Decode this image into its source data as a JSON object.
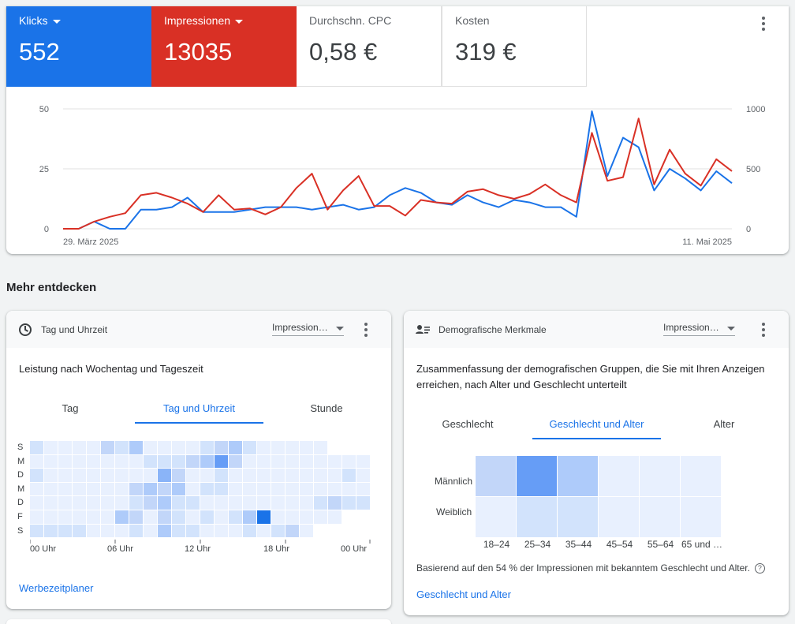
{
  "metrics": [
    {
      "label": "Klicks",
      "value": "552",
      "color": "#1a73e8"
    },
    {
      "label": "Impressionen",
      "value": "13035",
      "color": "#d93025"
    },
    {
      "label": "Durchschn. CPC",
      "value": "0,58 €"
    },
    {
      "label": "Kosten",
      "value": "319 €"
    }
  ],
  "chart_data": {
    "type": "line",
    "x_start_label": "29. März 2025",
    "x_end_label": "11. Mai 2025",
    "left_axis": {
      "ticks": [
        "0",
        "25",
        "50"
      ],
      "ylim": [
        0,
        50
      ]
    },
    "right_axis": {
      "ticks": [
        "0",
        "500",
        "1000"
      ],
      "ylim": [
        0,
        1000
      ]
    },
    "grid": true,
    "series": [
      {
        "name": "Klicks",
        "axis": "left",
        "color": "#1a73e8",
        "values": [
          0,
          0,
          3,
          0,
          0,
          8,
          8,
          9,
          13,
          7,
          7,
          7,
          8,
          9,
          9,
          9,
          8,
          9,
          10,
          8,
          9,
          14,
          17,
          15,
          11,
          10,
          14,
          11,
          9,
          12,
          11,
          9,
          9,
          5,
          49,
          22,
          38,
          34,
          16,
          25,
          21,
          16,
          24,
          19
        ]
      },
      {
        "name": "Impressionen",
        "axis": "right",
        "color": "#d93025",
        "values": [
          0,
          0,
          60,
          100,
          130,
          280,
          300,
          260,
          210,
          140,
          280,
          160,
          170,
          120,
          180,
          340,
          460,
          160,
          320,
          440,
          190,
          190,
          110,
          240,
          220,
          210,
          310,
          330,
          280,
          250,
          290,
          370,
          280,
          220,
          800,
          400,
          430,
          920,
          370,
          660,
          460,
          360,
          580,
          480
        ]
      }
    ]
  },
  "section_title": "Mehr entdecken",
  "card1": {
    "title": "Tag und Uhrzeit",
    "dropdown": "Impression…",
    "subtitle": "Leistung nach Wochentag und Tageszeit",
    "tabs": [
      "Tag",
      "Tag und Uhrzeit",
      "Stunde"
    ],
    "active_tab": 1,
    "row_labels": [
      "S",
      "M",
      "D",
      "M",
      "D",
      "F",
      "S"
    ],
    "x_ticks": [
      "00 Uhr",
      "06 Uhr",
      "12 Uhr",
      "18 Uhr",
      "00 Uhr"
    ],
    "link": "Werbezeitplaner",
    "heatmap_levels": [
      [
        2,
        1,
        1,
        1,
        1,
        3,
        2,
        4,
        1,
        1,
        1,
        1,
        2,
        3,
        4,
        2,
        1,
        1,
        1,
        1,
        1,
        0,
        0,
        0
      ],
      [
        1,
        1,
        1,
        1,
        1,
        1,
        1,
        1,
        2,
        2,
        2,
        3,
        4,
        6,
        3,
        1,
        1,
        1,
        1,
        1,
        1,
        1,
        1,
        1
      ],
      [
        2,
        1,
        1,
        1,
        1,
        1,
        1,
        1,
        1,
        5,
        3,
        1,
        1,
        2,
        1,
        1,
        1,
        1,
        1,
        1,
        1,
        1,
        2,
        1
      ],
      [
        1,
        1,
        1,
        1,
        1,
        1,
        1,
        3,
        4,
        3,
        4,
        1,
        2,
        2,
        1,
        1,
        1,
        1,
        1,
        1,
        1,
        1,
        1,
        1
      ],
      [
        1,
        1,
        1,
        1,
        1,
        1,
        1,
        2,
        3,
        4,
        2,
        2,
        1,
        1,
        1,
        1,
        1,
        1,
        1,
        1,
        2,
        3,
        2,
        2
      ],
      [
        1,
        1,
        1,
        1,
        1,
        1,
        4,
        3,
        1,
        3,
        2,
        1,
        2,
        1,
        2,
        4,
        7,
        1,
        1,
        1,
        1,
        1,
        0,
        0
      ],
      [
        2,
        2,
        2,
        2,
        1,
        1,
        1,
        2,
        1,
        4,
        2,
        2,
        1,
        1,
        1,
        2,
        1,
        2,
        3,
        1,
        0,
        0,
        0,
        0
      ]
    ]
  },
  "card2": {
    "title": "Demografische Merkmale",
    "dropdown": "Impression…",
    "subtitle": "Zusammenfassung der demografischen Gruppen, die Sie mit Ihren Anzeigen erreichen, nach Alter und Geschlecht unterteilt",
    "tabs": [
      "Geschlecht",
      "Geschlecht und Alter",
      "Alter"
    ],
    "active_tab": 1,
    "row_labels": [
      "Männlich",
      "Weiblich"
    ],
    "col_labels": [
      "18–24",
      "25–34",
      "35–44",
      "45–54",
      "55–64",
      "65 und …"
    ],
    "heatmap_levels": [
      [
        3,
        6,
        4,
        1,
        1,
        1
      ],
      [
        1,
        2,
        2,
        1,
        1,
        1
      ]
    ],
    "note": "Basierend auf den 54 % der Impressionen mit bekanntem Geschlecht und Alter.",
    "link": "Geschlecht und Alter"
  }
}
